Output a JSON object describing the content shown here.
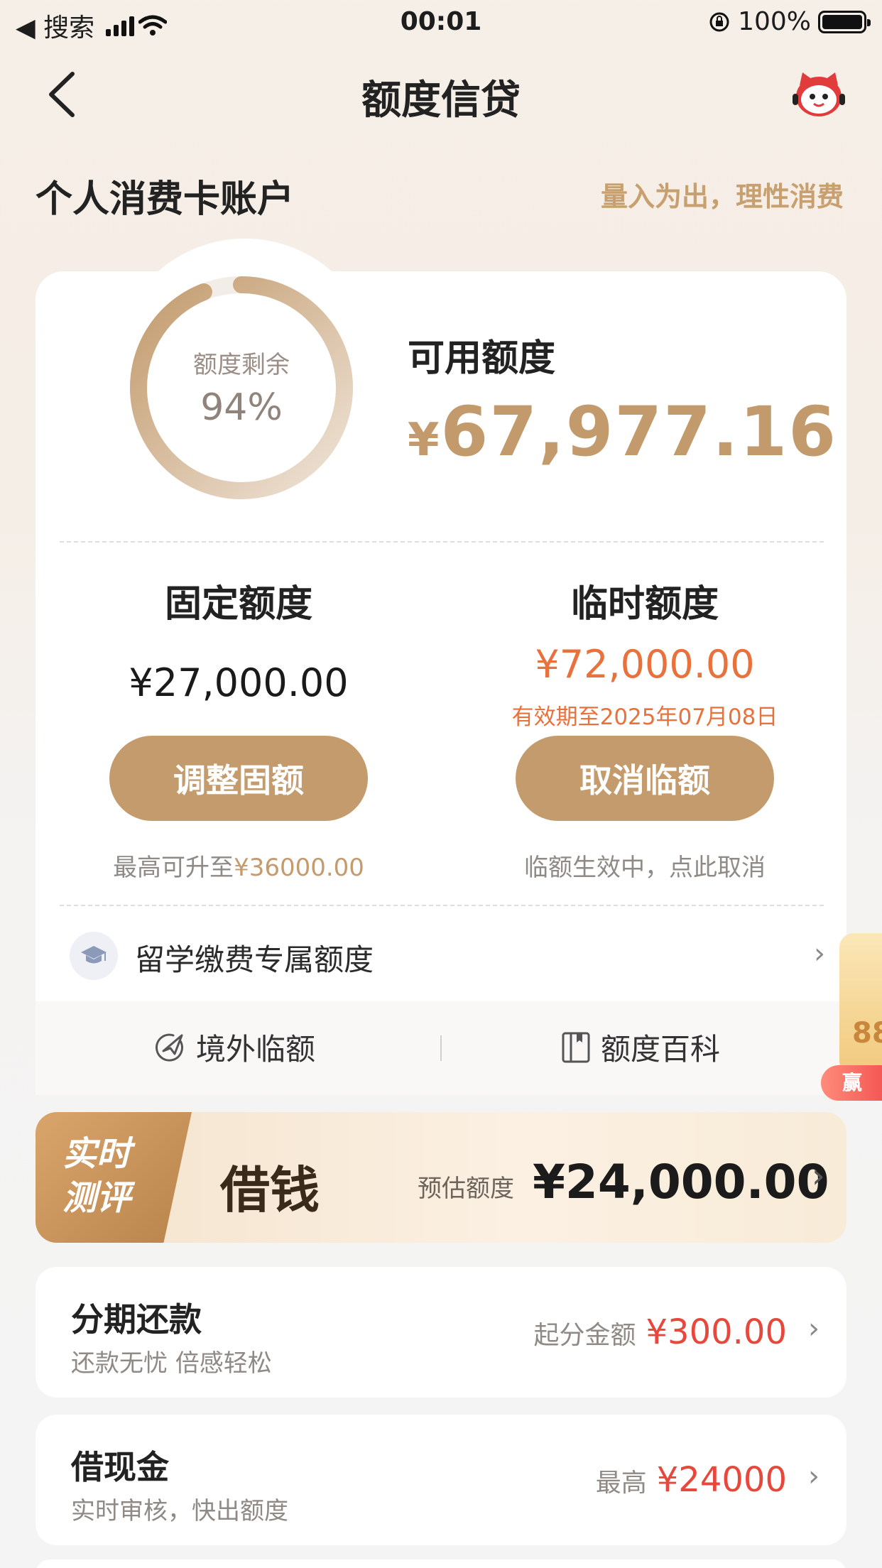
{
  "status_bar": {
    "back_app": "◀ 搜索",
    "time": "00:01",
    "battery": "100%"
  },
  "nav": {
    "title": "额度信贷"
  },
  "account": {
    "title": "个人消费卡账户",
    "slogan": "量入为出，理性消费"
  },
  "credit": {
    "ring_label": "额度剩余",
    "ring_percent": "94%",
    "ring_fraction": 0.94,
    "available_label": "可用额度",
    "available_currency": "¥",
    "available_amount": "67,977.16"
  },
  "fixed": {
    "title": "固定额度",
    "amount": "¥27,000.00",
    "button": "调整固额",
    "hint_prefix": "最高可升至",
    "hint_value": "¥36000.00"
  },
  "temporary": {
    "title": "临时额度",
    "amount": "¥72,000.00",
    "validity": "有效期至2025年07月08日",
    "button": "取消临额",
    "hint": "临额生效中，点此取消"
  },
  "study_abroad": {
    "label": "留学缴费专属额度"
  },
  "footer_links": {
    "overseas": "境外临额",
    "encyclopedia": "额度百科"
  },
  "promo": {
    "text": "88",
    "badge": "赢"
  },
  "borrow_banner": {
    "tag_line1": "实时",
    "tag_line2": "测评",
    "title": "借钱",
    "estimate_label": "预估额度",
    "estimate_amount": "¥24,000.00"
  },
  "installment": {
    "title": "分期还款",
    "subtitle": "还款无忧 倍感轻松",
    "label": "起分金额",
    "value": "¥300.00"
  },
  "cash": {
    "title": "借现金",
    "subtitle": "实时审核，快出额度",
    "label": "最高",
    "value": "¥24000"
  },
  "colors": {
    "gold": "#c49b6d",
    "orange": "#e8713c",
    "red": "#e8473c"
  }
}
